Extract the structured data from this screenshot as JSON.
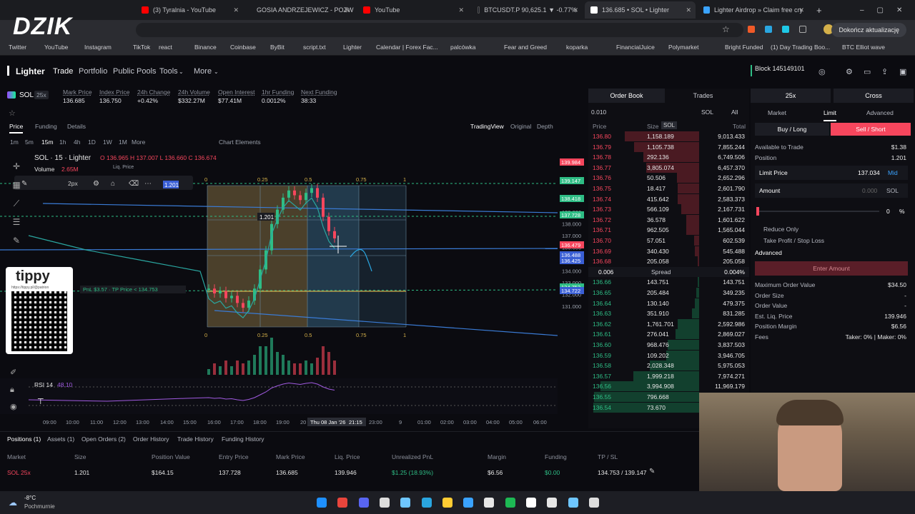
{
  "browser": {
    "tabs": [
      {
        "title": "(3) Tyralnia - YouTube",
        "color": "#ff0000"
      },
      {
        "title": "GOSIA ANDRZEJEWICZ - POZW",
        "color": "#ff0000"
      },
      {
        "title": "YouTube",
        "color": "#ff0000"
      },
      {
        "title": "BTCUSDT.P 90,625.1 ▼ -0.77%",
        "color": "#131722"
      },
      {
        "title": "136.685 • SOL • Lighter",
        "color": "#ffffff"
      },
      {
        "title": "Lighter Airdrop » Claim free cry",
        "color": "#3aa3ff"
      }
    ],
    "update": "Dokończ aktualizację",
    "bookmarks": [
      "Twitter",
      "YouTube",
      "Instagram",
      "TikTok",
      "react",
      "Binance",
      "Coinbase",
      "ByBit",
      "script.txt",
      "Lighter",
      "Calendar | Forex Fac...",
      "palcówka",
      "Fear and Greed",
      "",
      "koparka",
      "FinancialJuice",
      "Polymarket",
      "Bright Funded",
      "(1) Day Trading Boo...",
      "BTC Elliot wave"
    ]
  },
  "overlay": {
    "brand": "DZIK",
    "tippy": "tippy",
    "tippy_url": "https://tippy.pl/@patrion"
  },
  "nav": {
    "logo": "Lighter",
    "items": [
      "Trade",
      "Portfolio",
      "Public Pools",
      "Tools",
      "More"
    ],
    "block": "Block 145149101"
  },
  "market": {
    "symbol": "SOL",
    "leverage": "25x",
    "stats": [
      {
        "label": "Mark Price",
        "value": "136.685"
      },
      {
        "label": "Index Price",
        "value": "136.750"
      },
      {
        "label": "24h Change",
        "value": "+0.42%"
      },
      {
        "label": "24h Volume",
        "value": "$332.27M"
      },
      {
        "label": "Open Interest",
        "value": "$77.41M"
      },
      {
        "label": "1hr Funding",
        "value": "0.0012%"
      },
      {
        "label": "Next Funding",
        "value": "38:33"
      }
    ]
  },
  "chart": {
    "subtabs": [
      "Price",
      "Funding",
      "Details"
    ],
    "views": [
      "TradingView",
      "Original",
      "Depth"
    ],
    "intervals": [
      "1m",
      "5m",
      "15m",
      "1h",
      "4h",
      "1D",
      "1W",
      "1M",
      "More"
    ],
    "elements": "Chart Elements",
    "title": "SOL · 15 · Lighter",
    "ohlc": "O 136.965 H 137.007 L 136.660 C 136.674",
    "volume_label": "Volume",
    "volume_value": "2.65M",
    "tool_px": "2px",
    "rsi": "RSI 14",
    "rsi_value": "48.10",
    "date_label": "Thu 08 Jan '26",
    "time_label": "21:15",
    "times": [
      "09:00",
      "10:00",
      "11:00",
      "12:00",
      "13:00",
      "14:00",
      "15:00",
      "16:00",
      "17:00",
      "18:00",
      "19:00",
      "20",
      "23:00",
      "9",
      "01:00",
      "02:00",
      "03:00",
      "04:00",
      "05:00",
      "06:00"
    ],
    "prices": [
      "139.000",
      "138.000",
      "137.000",
      "136.000",
      "135.000",
      "134.000",
      "133.000",
      "132.000",
      "131.000"
    ],
    "price_tags": [
      "139.984",
      "139.147",
      "138.418",
      "137.728",
      "136.479",
      "136.488",
      "136.425",
      "134.753",
      "134.722"
    ],
    "fib": [
      "0",
      "0.25",
      "0.5",
      "0.75",
      "1"
    ],
    "pnl_label": "PnL $3.57 · TP Price < 134.753",
    "pos_qty": "1.201",
    "liq_price": "Liq. Price",
    "chart_data": {
      "type": "line",
      "series": [
        {
          "name": "SOL 15m close",
          "values": [
            134.6,
            134.4,
            134.5,
            134.2,
            134.3,
            134.0,
            133.8,
            134.1,
            134.6,
            135.4,
            136.2,
            137.3,
            137.9,
            138.4,
            138.7,
            138.5,
            138.3,
            138.6,
            138.8,
            138.4,
            137.6,
            137.0,
            136.7
          ]
        }
      ]
    }
  },
  "orderbook": {
    "tabs": [
      "Order Book",
      "Trades"
    ],
    "tick": "0.010",
    "sym": "SOL",
    "filter": "All",
    "headers": [
      "Price",
      "Size",
      "SOL",
      "Total"
    ],
    "asks": [
      [
        "136.80",
        "1,158.189",
        "9,013.433"
      ],
      [
        "136.79",
        "1,105.738",
        "7,855.244"
      ],
      [
        "136.78",
        "292.136",
        "6,749.506"
      ],
      [
        "136.77",
        "3,805.074",
        "6,457.370"
      ],
      [
        "136.76",
        "50.506",
        "2,652.296"
      ],
      [
        "136.75",
        "18.417",
        "2,601.790"
      ],
      [
        "136.74",
        "415.642",
        "2,583.373"
      ],
      [
        "136.73",
        "566.109",
        "2,167.731"
      ],
      [
        "136.72",
        "36.578",
        "1,601.622"
      ],
      [
        "136.71",
        "962.505",
        "1,565.044"
      ],
      [
        "136.70",
        "57.051",
        "602.539"
      ],
      [
        "136.69",
        "340.430",
        "545.488"
      ],
      [
        "136.68",
        "205.058",
        "205.058"
      ]
    ],
    "spread": [
      "0.006",
      "Spread",
      "0.004%"
    ],
    "bids": [
      [
        "136.66",
        "143.751",
        "143.751"
      ],
      [
        "136.65",
        "205.484",
        "349.235"
      ],
      [
        "136.64",
        "130.140",
        "479.375"
      ],
      [
        "136.63",
        "351.910",
        "831.285"
      ],
      [
        "136.62",
        "1,761.701",
        "2,592.986"
      ],
      [
        "136.61",
        "276.041",
        "2,869.027"
      ],
      [
        "136.60",
        "968.476",
        "3,837.503"
      ],
      [
        "136.59",
        "109.202",
        "3,946.705"
      ],
      [
        "136.58",
        "2,028.348",
        "5,975.053"
      ],
      [
        "136.57",
        "1,999.218",
        "7,974.271"
      ],
      [
        "136.56",
        "3,994.908",
        "11,969.179"
      ],
      [
        "136.55",
        "796.668",
        "12,765.847"
      ],
      [
        "136.54",
        "73.670",
        "12,839.517"
      ]
    ]
  },
  "order": {
    "leverage": "25x",
    "margin": "Cross",
    "types": [
      "Market",
      "Limit",
      "Advanced"
    ],
    "buy": "Buy / Long",
    "sell": "Sell / Short",
    "available_label": "Available to Trade",
    "available": "$1.38",
    "position_label": "Position",
    "position": "1.201",
    "limit_label": "Limit Price",
    "limit": "137.034",
    "mid": "Mid",
    "amount_label": "Amount",
    "amount": "0.000",
    "amount_sym": "SOL",
    "pct": "0",
    "reduce": "Reduce Only",
    "tpsl": "Take Profit / Stop Loss",
    "advanced": "Advanced",
    "enter": "Enter Amount",
    "rows": [
      [
        "Maximum Order Value",
        "$34.50"
      ],
      [
        "Order Size",
        "-"
      ],
      [
        "Order Value",
        "-"
      ],
      [
        "Est. Liq. Price",
        "139.946"
      ],
      [
        "Position Margin",
        "$6.56"
      ],
      [
        "Fees",
        "Taker: 0% | Maker: 0%"
      ]
    ]
  },
  "positions": {
    "tabs": [
      "Positions (1)",
      "Assets (1)",
      "Open Orders (2)",
      "Order History",
      "Trade History",
      "Funding History"
    ],
    "headers": [
      "Market",
      "Size",
      "Position Value",
      "Entry Price",
      "Mark Price",
      "Liq. Price",
      "Unrealized PnL",
      "Margin",
      "Funding",
      "TP / SL"
    ],
    "row": [
      "SOL 25x",
      "1.201",
      "$164.15",
      "137.728",
      "136.685",
      "139.946",
      "$1.25 (18.93%)",
      "$6.56",
      "$0.00",
      "134.753 / 139.147"
    ]
  },
  "taskbar": {
    "temp": "-8°C",
    "weather": "Pochmurnie"
  }
}
